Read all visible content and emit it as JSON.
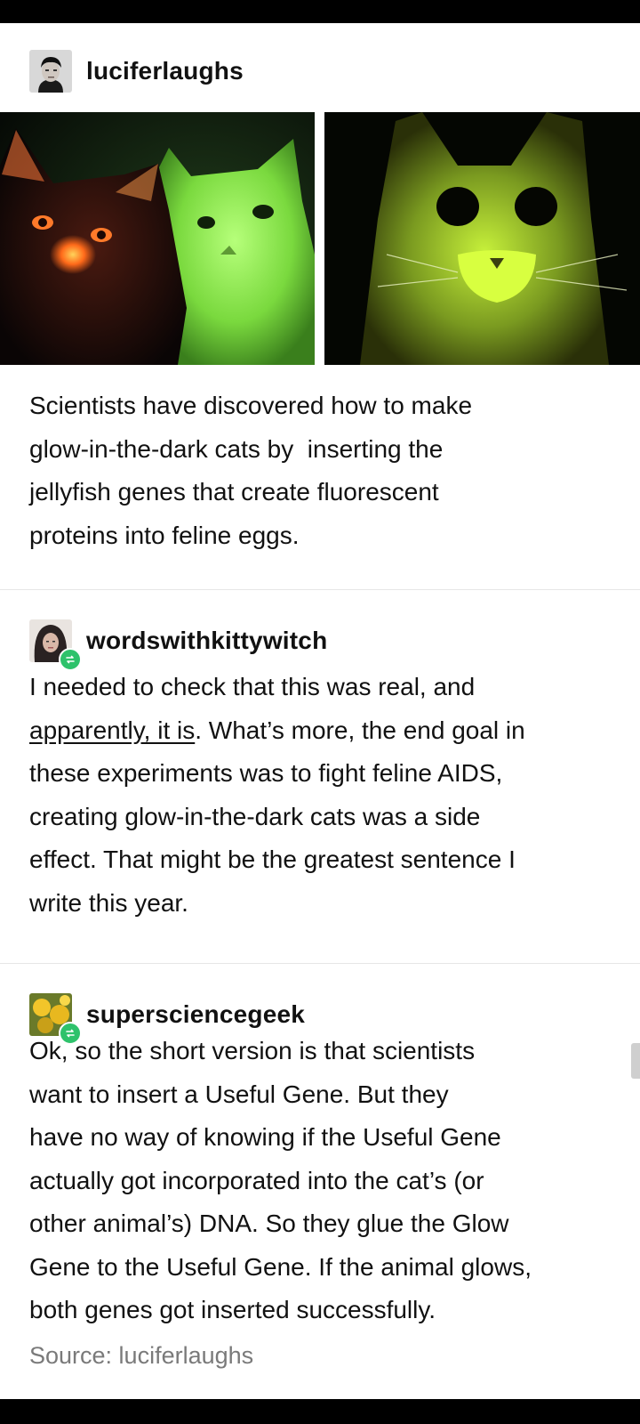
{
  "posts": [
    {
      "username": "luciferlaughs",
      "avatar_icon": "profile-photo-icon",
      "images": [
        {
          "name": "glowing-cats-photo-left",
          "description_icon": "cat-photo-icon"
        },
        {
          "name": "glowing-cat-photo-right",
          "description_icon": "cat-photo-icon"
        }
      ],
      "lines": [
        "Scientists have discovered how to make",
        "glow-in-the-dark cats by  inserting the",
        "jellyfish genes that create fluorescent",
        "proteins into feline eggs."
      ]
    },
    {
      "username": "wordswithkittywitch",
      "avatar_icon": "profile-photo-icon",
      "badge_icon": "reblog-icon",
      "line1": "I needed to check that this was real, and",
      "link_text": "apparently, it is",
      "line2_rest": ". What’s more, the end goal in",
      "lines_after": [
        "these experiments was to fight feline AIDS,",
        "creating glow-in-the-dark cats was a side",
        "effect. That might be the greatest sentence I",
        "write this year."
      ]
    },
    {
      "username": "supersciencegeek",
      "avatar_icon": "profile-photo-icon",
      "badge_icon": "reblog-icon",
      "lines": [
        "Ok, so the short version is that scientists",
        "want to insert a Useful Gene. But they",
        "have no way of knowing if the Useful Gene",
        "actually got incorporated into the cat’s (or",
        "other animal’s) DNA. So they glue the Glow",
        "Gene to the Useful Gene. If the animal glows,",
        "both genes got inserted successfully."
      ]
    }
  ],
  "source_text": "Source: luciferlaughs",
  "colors": {
    "reblog_badge": "#2ec26b",
    "text": "#111111",
    "source": "#7a7a7a",
    "divider": "#e6e6e6"
  }
}
